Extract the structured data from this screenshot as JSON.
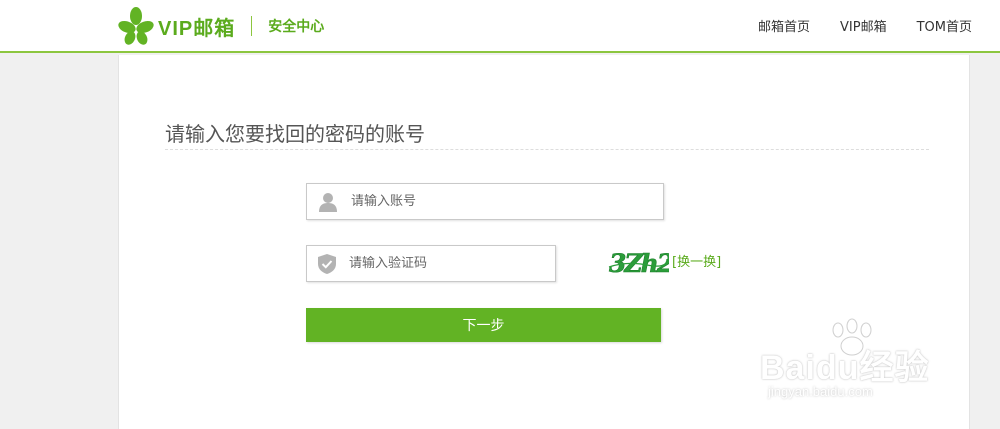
{
  "header": {
    "logo_text": "VIP邮箱",
    "subtitle": "安全中心",
    "nav": [
      "邮箱首页",
      "VIP邮箱",
      "TOM首页"
    ]
  },
  "main": {
    "title": "请输入您要找回的密码的账号",
    "account_placeholder": "请输入账号",
    "captcha_placeholder": "请输入验证码",
    "captcha_text": "3Zh2",
    "refresh_label": "[换一换]",
    "next_label": "下一步"
  },
  "watermark": {
    "main": "Baidu经验",
    "url": "jingyan.baidu.com"
  },
  "colors": {
    "brand_green": "#5bab1d",
    "button_green": "#62b324",
    "header_rule": "#8cc63f"
  },
  "icons": {
    "logo": "clover-logo-icon",
    "account": "user-icon",
    "captcha": "shield-check-icon"
  }
}
